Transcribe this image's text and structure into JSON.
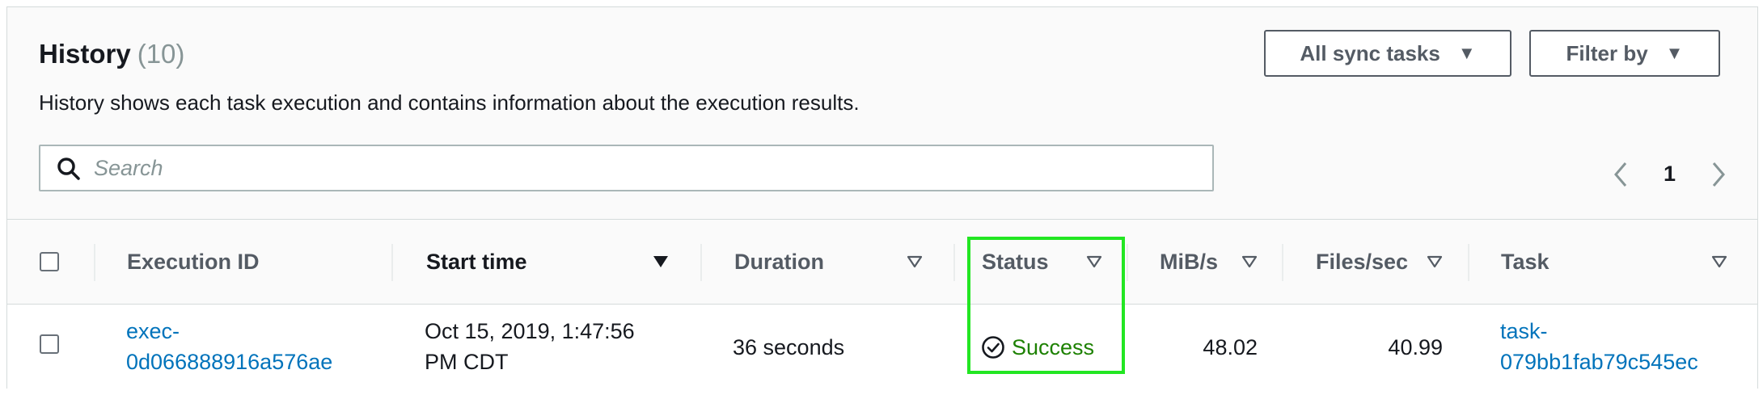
{
  "header": {
    "title": "History",
    "count": "(10)",
    "description": "History shows each task execution and contains information about the execution results."
  },
  "toolbar": {
    "sync_tasks_label": "All sync tasks",
    "filter_label": "Filter by"
  },
  "search": {
    "placeholder": "Search",
    "value": ""
  },
  "pagination": {
    "current_page": "1"
  },
  "table": {
    "columns": [
      {
        "label": "Execution ID",
        "sortable": false
      },
      {
        "label": "Start time",
        "sortable": true,
        "sorted": "descending"
      },
      {
        "label": "Duration",
        "sortable": true
      },
      {
        "label": "Status",
        "sortable": true
      },
      {
        "label": "MiB/s",
        "sortable": true
      },
      {
        "label": "Files/sec",
        "sortable": true
      },
      {
        "label": "Task",
        "sortable": true
      }
    ],
    "rows": [
      {
        "execution_id_line1": "exec-",
        "execution_id_line2": "0d066888916a576ae",
        "start_time_line1": "Oct 15, 2019, 1:47:56",
        "start_time_line2": "PM CDT",
        "duration": "36 seconds",
        "status": "Success",
        "mib_per_sec": "48.02",
        "files_per_sec": "40.99",
        "task_line1": "task-",
        "task_line2": "079bb1fab79c545ec"
      }
    ]
  },
  "colors": {
    "link": "#0073bb",
    "success": "#1d8102",
    "highlight": "#22e622"
  },
  "icons": {
    "search": "search-icon",
    "dropdown": "caret-down-icon",
    "sort_active": "sort-descending-icon",
    "sort_inactive": "sort-neutral-icon",
    "prev": "chevron-left-icon",
    "next": "chevron-right-icon",
    "status": "check-circle-icon"
  }
}
